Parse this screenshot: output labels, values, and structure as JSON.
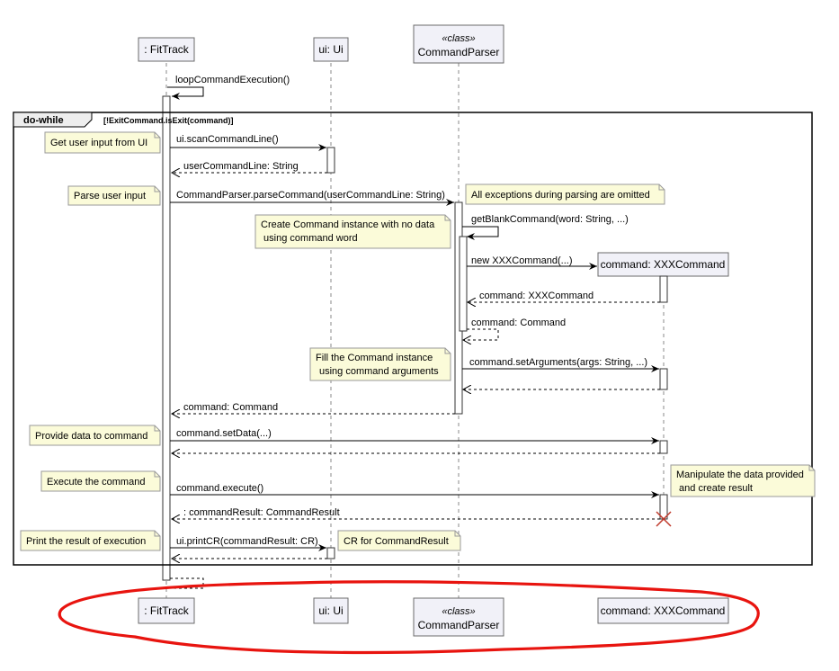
{
  "participants": {
    "fittrack": ": FitTrack",
    "ui": "ui: Ui",
    "parser_stereotype": "«class»",
    "parser": "CommandParser",
    "xxx": "command: XXXCommand"
  },
  "fragment": {
    "operator": "do-while",
    "guard": "[!ExitCommand.isExit(command)]"
  },
  "messages": {
    "loop": "loopCommandExecution()",
    "scan": "ui.scanCommandLine()",
    "scan_ret": "userCommandLine: String",
    "parse": "CommandParser.parseCommand(userCommandLine: String)",
    "blank": "getBlankCommand(word: String, ...)",
    "new_cmd": "new XXXCommand(...)",
    "new_ret": "command: XXXCommand",
    "blank_ret": "command: Command",
    "set_args": "command.setArguments(args: String, ...)",
    "parse_ret": "command: Command",
    "set_data": "command.setData(...)",
    "execute": "command.execute()",
    "execute_ret": ": commandResult: CommandResult",
    "print": "ui.printCR(commandResult: CR)"
  },
  "notes": {
    "get_input": "Get user input from UI",
    "parse_input": "Parse user input",
    "exceptions": "All exceptions during parsing are omitted",
    "create_line1": "Create Command instance with no data",
    "create_line2": " using command word",
    "fill_line1": "Fill the Command instance",
    "fill_line2": "using command arguments",
    "provide": "Provide data to command",
    "execute": "Execute the command",
    "manip_line1": "Manipulate the data provided",
    "manip_line2": " and create result",
    "print": "Print the result of execution",
    "cr": "CR for CommandResult"
  },
  "colors": {
    "participant_fill": "#f1f1f8",
    "note_fill": "#fbfbd9",
    "highlight_stroke": "#e8140f",
    "destroy_mark": "#c0392b"
  }
}
